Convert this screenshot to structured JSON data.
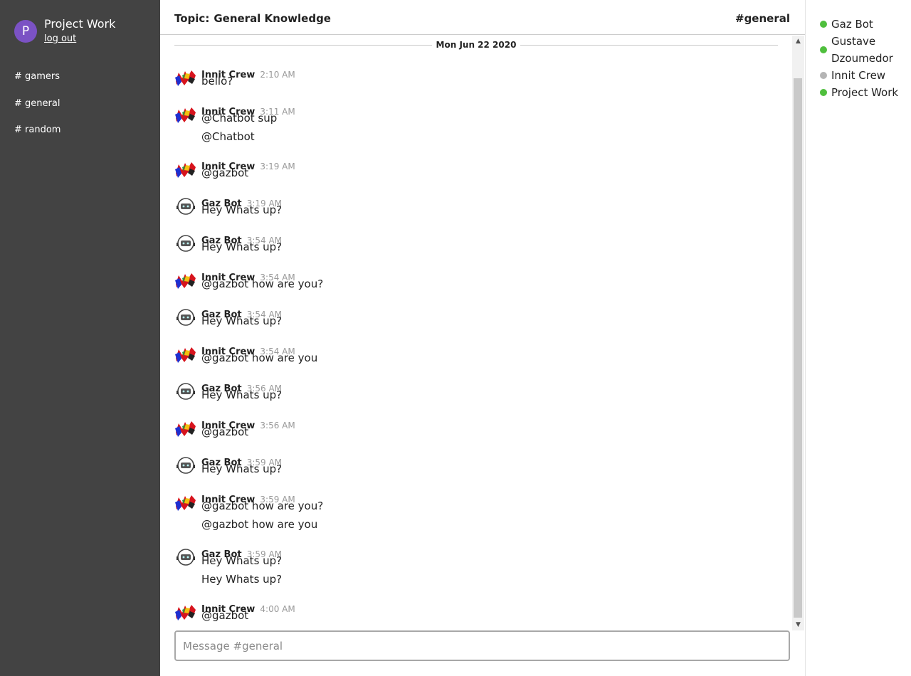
{
  "user": {
    "initial": "P",
    "name": "Project Work",
    "logout_label": "log out"
  },
  "channels": [
    "# gamers",
    "# general",
    "# random"
  ],
  "topic": {
    "label": "Topic:",
    "value": "General Knowledge"
  },
  "current_channel": "#general",
  "date_divider": "Mon Jun 22 2020",
  "messages": [
    {
      "author": "Innit Crew",
      "time": "2:10 AM",
      "lines": [
        "bello?"
      ]
    },
    {
      "author": "Innit Crew",
      "time": "3:11 AM",
      "lines": [
        "@Chatbot sup",
        "@Chatbot"
      ]
    },
    {
      "author": "Innit Crew",
      "time": "3:19 AM",
      "lines": [
        "@gazbot"
      ]
    },
    {
      "author": "Gaz Bot",
      "time": "3:19 AM",
      "lines": [
        "Hey Whats up?"
      ]
    },
    {
      "author": "Gaz Bot",
      "time": "3:54 AM",
      "lines": [
        "Hey Whats up?"
      ]
    },
    {
      "author": "Innit Crew",
      "time": "3:54 AM",
      "lines": [
        "@gazbot how are you?"
      ]
    },
    {
      "author": "Gaz Bot",
      "time": "3:54 AM",
      "lines": [
        "Hey Whats up?"
      ]
    },
    {
      "author": "Innit Crew",
      "time": "3:54 AM",
      "lines": [
        "@gazbot how are you"
      ]
    },
    {
      "author": "Gaz Bot",
      "time": "3:56 AM",
      "lines": [
        "Hey Whats up?"
      ]
    },
    {
      "author": "Innit Crew",
      "time": "3:56 AM",
      "lines": [
        "@gazbot"
      ]
    },
    {
      "author": "Gaz Bot",
      "time": "3:59 AM",
      "lines": [
        "Hey Whats up?"
      ]
    },
    {
      "author": "Innit Crew",
      "time": "3:59 AM",
      "lines": [
        "@gazbot how are you?",
        "@gazbot how are you"
      ]
    },
    {
      "author": "Gaz Bot",
      "time": "3:59 AM",
      "lines": [
        "Hey Whats up?",
        "Hey Whats up?"
      ]
    },
    {
      "author": "Innit Crew",
      "time": "4:00 AM",
      "lines": [
        "@gazbot"
      ]
    }
  ],
  "composer": {
    "placeholder": "Message #general"
  },
  "members": [
    {
      "name": "Gaz Bot",
      "status": "online",
      "color": "#4fbf3d"
    },
    {
      "name": "Gustave Dzoumedor",
      "status": "online",
      "color": "#4fbf3d"
    },
    {
      "name": "Innit Crew",
      "status": "offline",
      "color": "#b4b4b4"
    },
    {
      "name": "Project Work",
      "status": "online",
      "color": "#4fbf3d"
    }
  ],
  "colors": {
    "sidebar": "#434343",
    "avatar": "#7b52c4",
    "online": "#4fbf3d",
    "offline": "#b4b4b4"
  },
  "icons": {
    "crew_avatar": "innit-crew-logo-icon",
    "bot_avatar": "gaz-bot-robot-icon",
    "scroll_up": "chevron-up-icon",
    "scroll_down": "chevron-down-icon"
  }
}
